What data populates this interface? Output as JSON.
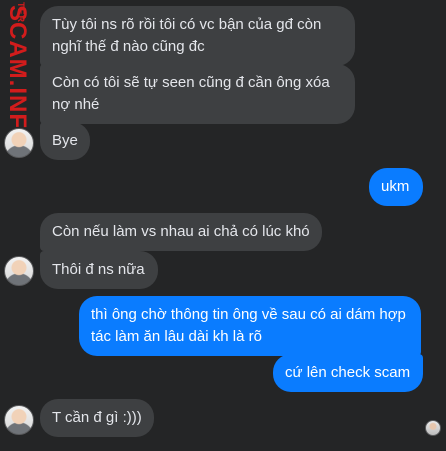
{
  "watermark": {
    "main": "SCAM.INFO",
    "tag": "TER"
  },
  "messages": [
    {
      "side": "in",
      "text": "Tùy tôi ns rõ rồi tôi có vc bận của gđ còn nghĩ thế đ nào cũng đc"
    },
    {
      "side": "in",
      "text": "Còn có tôi sẽ tự seen cũng đ cần ông xóa nợ nhé"
    },
    {
      "side": "in",
      "text": "Bye"
    },
    {
      "side": "out",
      "text": "ukm"
    },
    {
      "side": "in",
      "text": "Còn nếu làm vs nhau ai chả có lúc khó"
    },
    {
      "side": "in",
      "text": "Thôi đ ns nữa"
    },
    {
      "side": "out",
      "text": "thì ông chờ thông tin ông về sau có ai dám hợp tác làm ăn lâu dài kh là rõ"
    },
    {
      "side": "out",
      "text": "cứ lên check scam"
    },
    {
      "side": "in",
      "text": "T cần đ gì :)))"
    }
  ],
  "colors": {
    "incoming": "#3e4042",
    "outgoing": "#0a7cff",
    "background": "#242526",
    "watermark": "#d21c1c"
  }
}
